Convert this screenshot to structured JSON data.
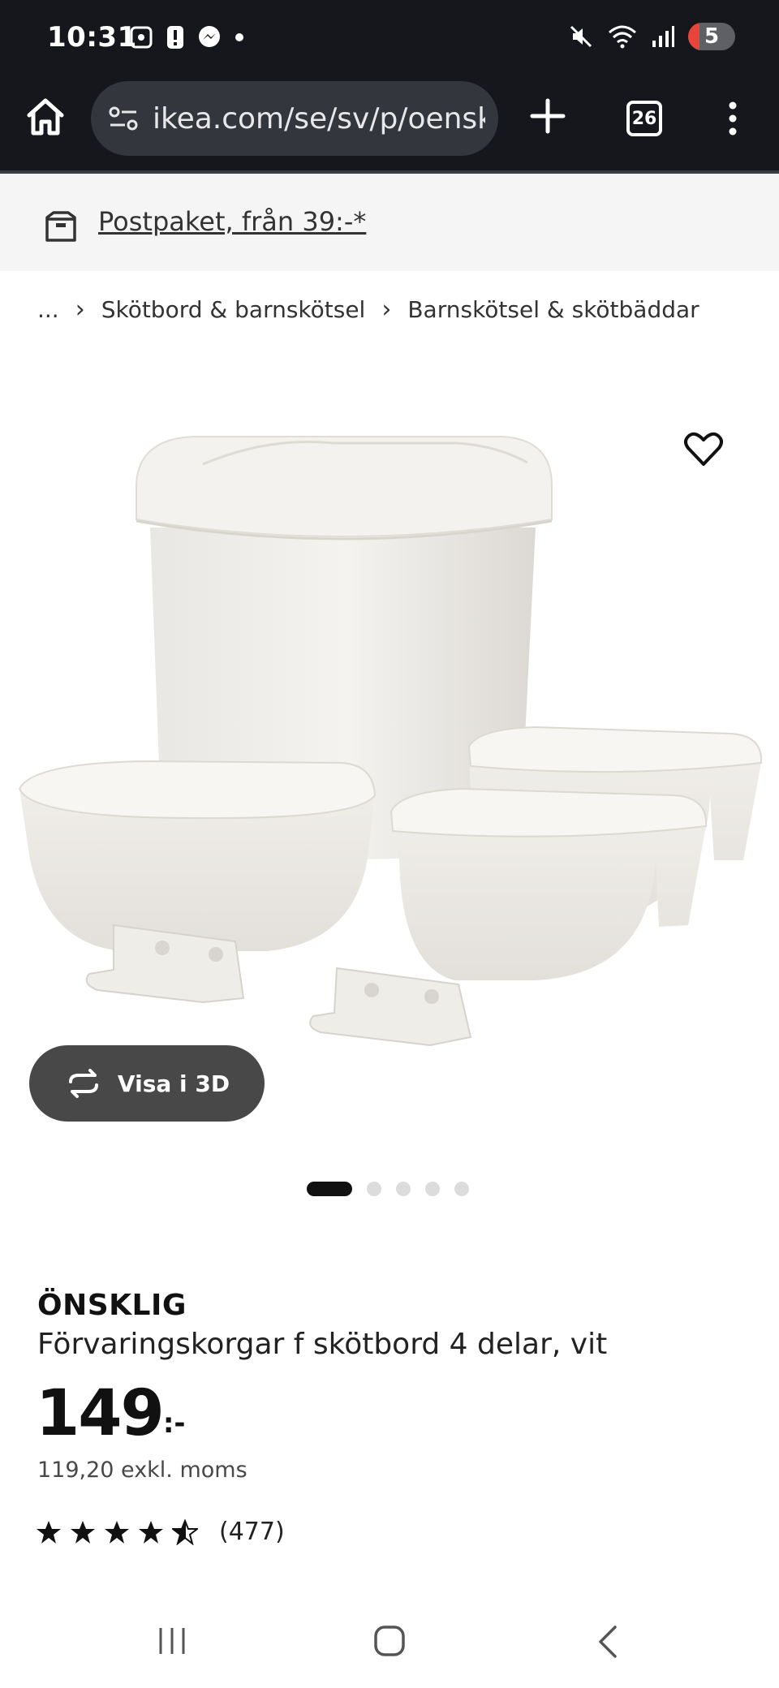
{
  "status_bar": {
    "time": "10:31",
    "battery": "5",
    "icons": [
      "screenshot-icon",
      "alert-icon",
      "messenger-icon",
      "dot-icon",
      "mute-icon",
      "wifi-icon",
      "signal-icon",
      "battery-icon"
    ]
  },
  "browser": {
    "url": "ikea.com/se/sv/p/oensklig",
    "tab_count": "26"
  },
  "banner": {
    "text": "Postpaket, från 39:-*"
  },
  "breadcrumb": {
    "ellipsis": "...",
    "items": [
      {
        "label": "Skötbord & barnskötsel"
      },
      {
        "label": "Barnskötsel & skötbäddar"
      }
    ]
  },
  "gallery": {
    "view_3d_label": "Visa i 3D",
    "image_count": 5,
    "active_index": 0
  },
  "product": {
    "brand": "ÖNSKLIG",
    "description": "Förvaringskorgar f skötbord 4 delar, vit",
    "price": "149",
    "price_suffix": ":-",
    "price_excl_vat": "119,20 exkl. moms",
    "rating": 4.5,
    "review_count": "(477)"
  },
  "colors": {
    "chrome_bg": "#15171c",
    "url_bg": "#33363c",
    "banner_bg": "#f5f5f5",
    "button_dark": "#484848",
    "text": "#111111"
  }
}
